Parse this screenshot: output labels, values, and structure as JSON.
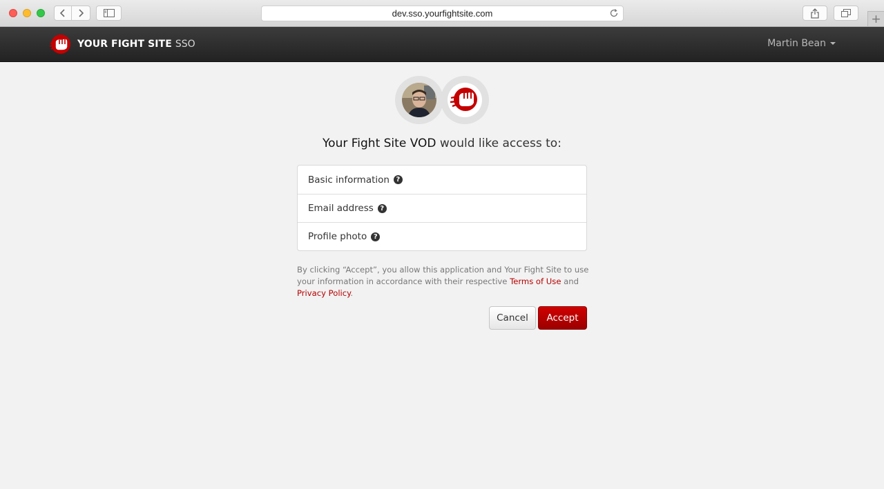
{
  "browser": {
    "url": "dev.sso.yourfightsite.com",
    "new_tab": "+"
  },
  "navbar": {
    "brand_strong": "YOUR FIGHT SITE",
    "brand_light": "SSO",
    "user_name": "Martin Bean"
  },
  "consent": {
    "app_owner": "Your Fight Site",
    "app_name": "VOD",
    "heading_suffix": "would like access to:",
    "permissions": [
      {
        "label": "Basic information"
      },
      {
        "label": "Email address"
      },
      {
        "label": "Profile photo"
      }
    ],
    "help_glyph": "?",
    "terms_prefix": "By clicking “Accept”, you allow this application and Your Fight Site to use your information in accordance with their respective",
    "terms_link": "Terms of Use",
    "terms_and": "and",
    "privacy_link": "Privacy Policy",
    "terms_end": ".",
    "cancel_label": "Cancel",
    "accept_label": "Accept"
  },
  "colors": {
    "accent": "#b70000",
    "navbar": "#2b2b2b",
    "page_bg": "#f2f2f2"
  }
}
